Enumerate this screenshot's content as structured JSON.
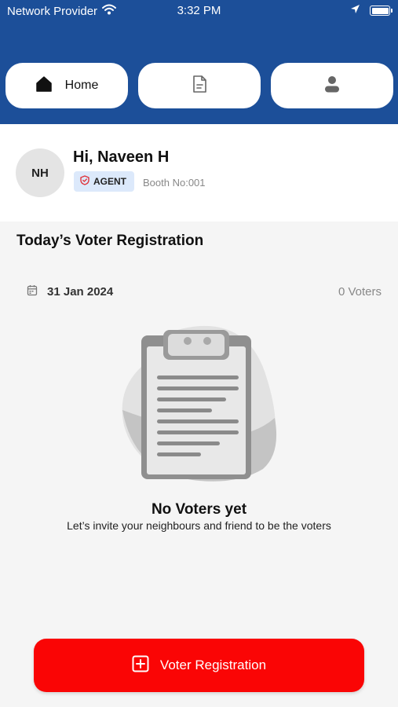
{
  "status_bar": {
    "carrier": "Network Provider",
    "time": "3:32 PM",
    "icons": [
      "wifi-icon",
      "location-arrow-icon",
      "battery-icon"
    ]
  },
  "nav": {
    "tabs": [
      {
        "label": "Home",
        "icon": "home-icon",
        "active": true
      },
      {
        "label": "",
        "icon": "document-icon",
        "active": false
      },
      {
        "label": "",
        "icon": "user-icon",
        "active": false
      }
    ]
  },
  "profile": {
    "initials": "NH",
    "greeting": "Hi, Naveen H",
    "role_badge": "AGENT",
    "role_icon": "shield-icon",
    "booth": "Booth No:001"
  },
  "registration": {
    "title": "Today’s Voter Registration",
    "date": "31 Jan 2024",
    "date_icon": "calendar-icon",
    "voter_count": "0 Voters"
  },
  "empty_state": {
    "illustration": "clipboard-illustration",
    "title": "No Voters yet",
    "subtitle": "Let’s invite your neighbours and friend to be the voters"
  },
  "cta": {
    "label": "Voter Registration",
    "icon": "plus-square-icon"
  },
  "colors": {
    "header": "#1c4f99",
    "cta": "#fa0505",
    "badge_bg": "#dce9fb",
    "shield": "#e0333a"
  }
}
